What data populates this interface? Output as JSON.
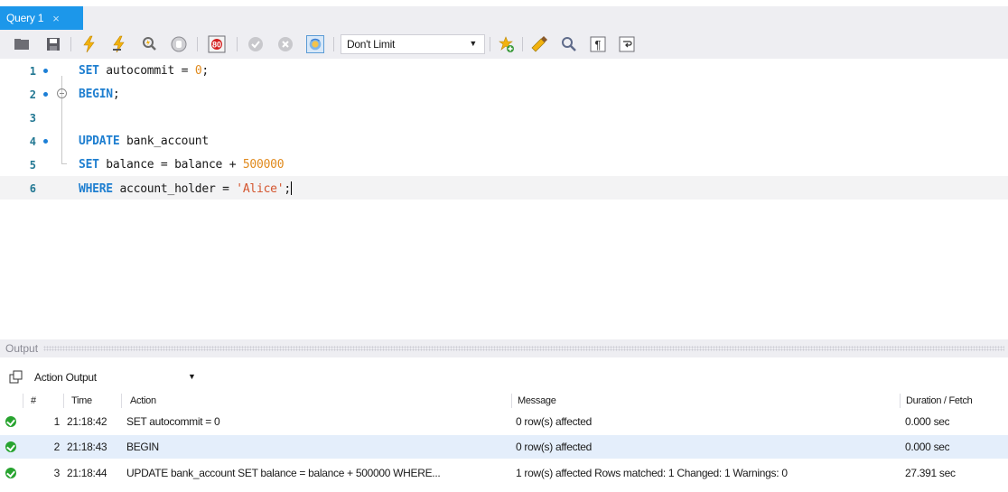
{
  "tabs": [
    {
      "label": "Query 1",
      "close": "×",
      "active": true
    }
  ],
  "toolbar": {
    "limit_value": "Don't Limit",
    "icons": [
      "open-file-icon",
      "save-icon",
      "execute-icon",
      "execute-current-icon",
      "explain-icon",
      "stop-icon",
      "toggle-stop-on-error-icon",
      "commit-icon",
      "rollback-icon",
      "autocommit-icon",
      "limit-dropdown",
      "add-snippet-icon",
      "beautify-icon",
      "find-icon",
      "invisible-chars-icon",
      "wrap-icon"
    ]
  },
  "editor": {
    "lines": [
      {
        "num": "1",
        "marker": true,
        "fold": false,
        "tokens": [
          {
            "t": "SET",
            "c": "kw"
          },
          {
            "t": " autocommit = ",
            "c": ""
          },
          {
            "t": "0",
            "c": "num"
          },
          {
            "t": ";",
            "c": ""
          }
        ]
      },
      {
        "num": "2",
        "marker": true,
        "fold": true,
        "tokens": [
          {
            "t": "BEGIN",
            "c": "kw"
          },
          {
            "t": ";",
            "c": ""
          }
        ]
      },
      {
        "num": "3",
        "marker": false,
        "fold": false,
        "tokens": []
      },
      {
        "num": "4",
        "marker": true,
        "fold": false,
        "tokens": [
          {
            "t": "UPDATE",
            "c": "kw"
          },
          {
            "t": " bank_account",
            "c": ""
          }
        ]
      },
      {
        "num": "5",
        "marker": false,
        "fold": false,
        "tokens": [
          {
            "t": "SET",
            "c": "kw"
          },
          {
            "t": " balance = balance + ",
            "c": ""
          },
          {
            "t": "500000",
            "c": "num"
          }
        ]
      },
      {
        "num": "6",
        "marker": false,
        "fold": false,
        "current": true,
        "tokens": [
          {
            "t": "WHERE",
            "c": "kw"
          },
          {
            "t": " account_holder = ",
            "c": ""
          },
          {
            "t": "'Alice'",
            "c": "str"
          },
          {
            "t": ";",
            "c": ""
          }
        ]
      }
    ]
  },
  "output": {
    "title": "Output",
    "type_selector": "Action Output",
    "columns": {
      "num": "#",
      "time": "Time",
      "action": "Action",
      "message": "Message",
      "duration": "Duration / Fetch"
    },
    "rows": [
      {
        "num": "1",
        "time": "21:18:42",
        "action": "SET autocommit = 0",
        "message": "0 row(s) affected",
        "duration": "0.000 sec",
        "status": "success"
      },
      {
        "num": "2",
        "time": "21:18:43",
        "action": "BEGIN",
        "message": "0 row(s) affected",
        "duration": "0.000 sec",
        "status": "success"
      },
      {
        "num": "3",
        "time": "21:18:44",
        "action": "UPDATE bank_account  SET balance = balance + 500000  WHERE...",
        "message": "1 row(s) affected Rows matched: 1  Changed: 1  Warnings: 0",
        "duration": "27.391 sec",
        "status": "success"
      }
    ]
  },
  "colors": {
    "accent": "#1c97ea",
    "keyword": "#1f7fd0",
    "number": "#e08a1d",
    "string": "#d4552e",
    "success": "#27a32f",
    "selected_row": "#e4eefb"
  }
}
